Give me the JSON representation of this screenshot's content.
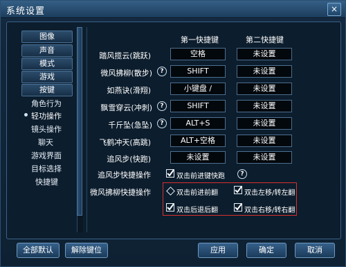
{
  "window": {
    "title": "系统设置",
    "close_label": "×"
  },
  "sidebar": {
    "buttons": [
      "图像",
      "声音",
      "模式",
      "游戏",
      "按键"
    ],
    "items": [
      "角色行为",
      "轻功操作",
      "镜头操作",
      "聊天",
      "游戏界面",
      "目标选择",
      "快捷键"
    ],
    "active_item": "轻功操作"
  },
  "columns": {
    "primary": "第一快捷键",
    "secondary": "第二快捷键"
  },
  "rows": [
    {
      "label": "踏风揽云(跳跃)",
      "primary": "空格",
      "secondary": "未设置",
      "help": false
    },
    {
      "label": "微风拂柳(散步)",
      "primary": "SHIFT",
      "secondary": "未设置",
      "help": true
    },
    {
      "label": "如燕诀(滑翔)",
      "primary": "小键盘 /",
      "secondary": "未设置",
      "help": false
    },
    {
      "label": "飘雪穿云(冲刺)",
      "primary": "SHIFT",
      "secondary": "未设置",
      "help": true
    },
    {
      "label": "千斤坠(急坠)",
      "primary": "ALT+S",
      "secondary": "未设置",
      "help": true
    },
    {
      "label": "飞鹤冲天(高跳)",
      "primary": "ALT+空格",
      "secondary": "未设置",
      "help": false
    },
    {
      "label": "追风步(快跑)",
      "primary": "未设置",
      "secondary": "未设置",
      "help": false
    }
  ],
  "chase_step": {
    "label": "追风步快捷操作",
    "option": "双击前进键快跑",
    "checked": true
  },
  "breeze": {
    "label": "微风拂柳快捷操作",
    "options": [
      {
        "label": "双击前进前翻",
        "checked": false
      },
      {
        "label": "双击左移/转左翻",
        "checked": true
      },
      {
        "label": "双击后退后翻",
        "checked": true
      },
      {
        "label": "双击右移/转右翻",
        "checked": true
      }
    ]
  },
  "footer": {
    "reset_all": "全部默认",
    "unbind": "解除键位",
    "apply": "应用",
    "ok": "确定",
    "cancel": "取消"
  },
  "help_glyph": "?"
}
